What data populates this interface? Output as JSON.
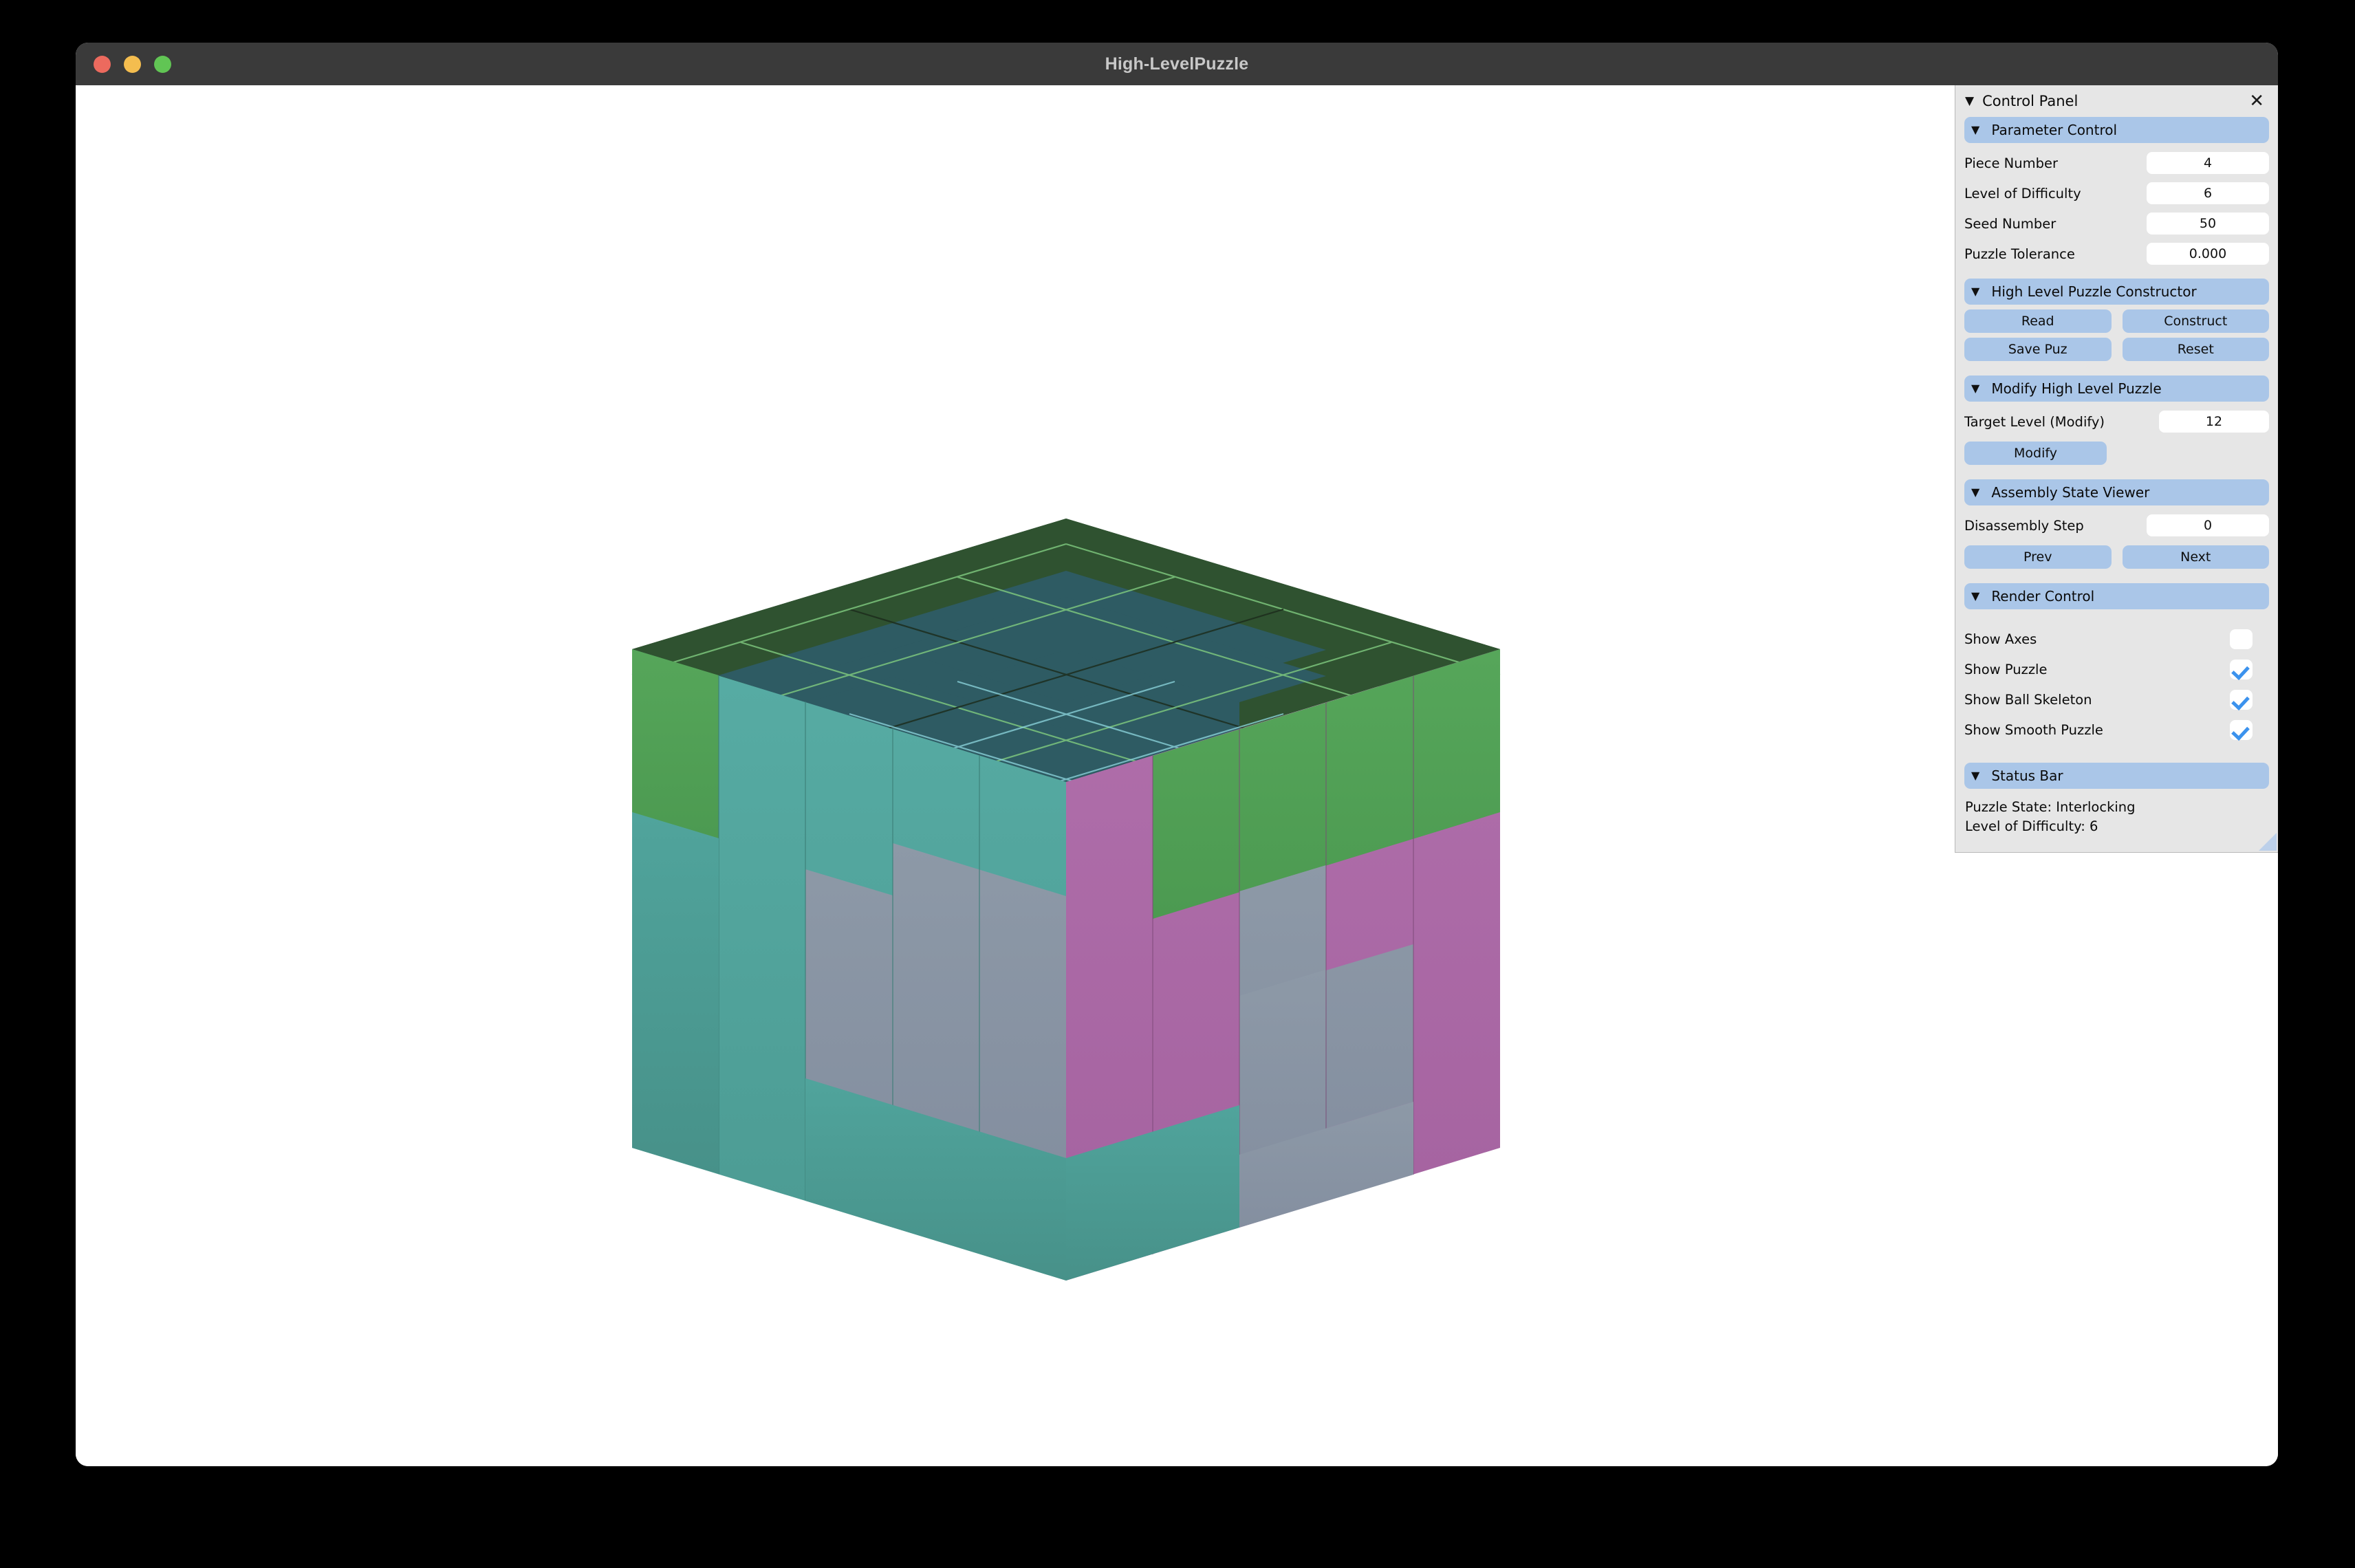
{
  "window": {
    "title": "High-LevelPuzzle",
    "traffic_lights": [
      "close",
      "minimize",
      "maximize"
    ],
    "colors": {
      "titlebar_bg": "#3a3a3a",
      "close": "#ec6a5e",
      "minimize": "#f4bd4f",
      "maximize": "#61c554",
      "canvas_bg": "#ffffff"
    }
  },
  "panel": {
    "title": "Control Panel",
    "caret": "▼",
    "close_icon": "✕",
    "colors": {
      "panel_bg": "#e6e6e6",
      "section_header_bg": "#aac6e8",
      "button_bg": "#aac6e8",
      "input_bg": "#ffffff",
      "check_accent": "#3b92ed"
    },
    "sections": [
      {
        "id": "parameter-control",
        "title": "Parameter Control",
        "fields": [
          {
            "label": "Piece Number",
            "value": "4"
          },
          {
            "label": "Level of Difficulty",
            "value": "6"
          },
          {
            "label": "Seed Number",
            "value": "50"
          },
          {
            "label": "Puzzle Tolerance",
            "value": "0.000"
          }
        ]
      },
      {
        "id": "high-level-puzzle-constructor",
        "title": "High Level Puzzle Constructor",
        "buttons": [
          [
            "Read",
            "Construct"
          ],
          [
            "Save Puz",
            "Reset"
          ]
        ]
      },
      {
        "id": "modify-high-level-puzzle",
        "title": "Modify High Level Puzzle",
        "fields": [
          {
            "label": "Target Level (Modify)",
            "value": "12"
          }
        ],
        "buttons": [
          [
            "Modify"
          ]
        ]
      },
      {
        "id": "assembly-state-viewer",
        "title": "Assembly State Viewer",
        "fields": [
          {
            "label": "Disassembly Step",
            "value": "0"
          }
        ],
        "buttons": [
          [
            "Prev",
            "Next"
          ]
        ]
      },
      {
        "id": "render-control",
        "title": "Render Control",
        "checkboxes": [
          {
            "label": "Show Axes",
            "checked": false
          },
          {
            "label": "Show Puzzle",
            "checked": true
          },
          {
            "label": "Show Ball Skeleton",
            "checked": true
          },
          {
            "label": "Show Smooth Puzzle",
            "checked": true
          }
        ]
      },
      {
        "id": "status-bar",
        "title": "Status Bar",
        "status_lines": [
          "Puzzle State: Interlocking",
          "Level of Difficulty: 6"
        ]
      }
    ]
  },
  "viewport": {
    "object": "interlocking-burr-puzzle-cube",
    "piece_colors": {
      "top_dark_green": "#2f5230",
      "top_dark_teal": "#2e5b63",
      "side_green": "#4f9f53",
      "side_teal": "#4fa39b",
      "side_teal_dark": "#4a9a93",
      "side_gray": "#8894a3",
      "side_magenta": "#ab69a5",
      "grid_line_green": "#7fc97f",
      "grid_line_cyan": "#8fd8e0",
      "grid_line_dark": "#1c2c1c"
    },
    "top_face_grid": {
      "rows": 4,
      "cols": 4
    }
  }
}
